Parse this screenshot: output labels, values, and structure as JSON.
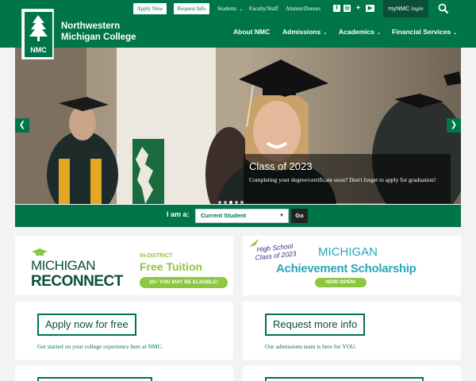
{
  "header": {
    "college_name_line1": "Northwestern",
    "college_name_line2": "Michigan College",
    "logo_text": "NMC",
    "utility": {
      "apply_now": "Apply Now",
      "request_info": "Request Info",
      "students": "Students",
      "faculty_staff": "Faculty/Staff",
      "alumni_donors": "Alumni/Donors"
    },
    "social_icons": [
      "facebook-icon",
      "instagram-icon",
      "twitter-icon",
      "youtube-icon"
    ],
    "mynmc": "myNMC",
    "mynmc_login": "login",
    "nav": [
      {
        "label": "About NMC"
      },
      {
        "label": "Admissions"
      },
      {
        "label": "Academics"
      },
      {
        "label": "Financial Services"
      }
    ]
  },
  "hero": {
    "caption_title": "Class of 2023",
    "caption_text": "Completing your degree/certificate soon? Don't forget to apply for graduation!",
    "slide_count": 5,
    "active_slide": 3
  },
  "iam": {
    "label": "I am a:",
    "selected": "Current Student",
    "go": "Go"
  },
  "promos": {
    "reconnect": {
      "michigan": "MICHIGAN",
      "reconnect": "RECONNECT",
      "in_district": "IN-DISTRICT",
      "free_tuition": "Free Tuition",
      "pill": "25+ YOU MAY BE ELIGIBLE!"
    },
    "scholarship": {
      "hs_line1": "High School",
      "hs_line2": "Class of 2023",
      "michigan": "MICHIGAN",
      "title": "Achievement Scholarship",
      "pill": "NOW OPEN!"
    }
  },
  "cta": {
    "apply_title": "Apply now for free",
    "apply_sub": "Get started on your college experience here at NMC.",
    "request_title": "Request more info",
    "request_sub": "Our admissions team is here for YOU."
  },
  "colors": {
    "brand_green": "#00754a",
    "dark_green": "#0a4f36",
    "lime": "#8dc63f",
    "teal": "#2aa6b7",
    "purple": "#3d2a87"
  }
}
